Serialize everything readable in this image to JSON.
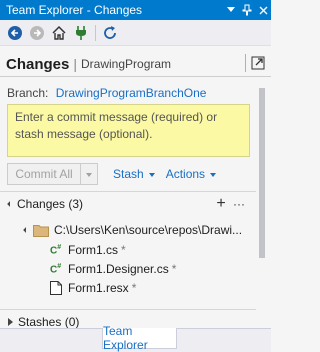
{
  "window": {
    "title": "Team Explorer - Changes",
    "title_buttons": [
      "chevron-down-icon",
      "pin-icon",
      "close-icon"
    ]
  },
  "toolbar": {
    "buttons": [
      "back-icon",
      "forward-icon",
      "home-icon",
      "connect-icon",
      "refresh-icon"
    ]
  },
  "page": {
    "title": "Changes",
    "repo": "DrawingProgram"
  },
  "branch": {
    "label": "Branch:",
    "name": "DrawingProgramBranchOne"
  },
  "commit": {
    "placeholder": "Enter a commit message (required) or stash message (optional).",
    "commit_button": "Commit All",
    "stash_button": "Stash",
    "actions_button": "Actions"
  },
  "changes": {
    "header": "Changes (3)",
    "folder": "C:\\Users\\Ken\\source\\repos\\Drawi...",
    "files": [
      {
        "name": "Form1.cs",
        "status": "*",
        "icon": "csharp-file-icon"
      },
      {
        "name": "Form1.Designer.cs",
        "status": "*",
        "icon": "csharp-file-icon"
      },
      {
        "name": "Form1.resx",
        "status": "*",
        "icon": "resource-file-icon"
      }
    ]
  },
  "stashes": {
    "header": "Stashes (0)"
  },
  "bottom_tab": {
    "label": "Team Explorer"
  },
  "colors": {
    "accent": "#007acc",
    "link": "#1a6fc4",
    "commit_box": "#fbf9a4",
    "csharp_icon": "#2f7d32"
  }
}
